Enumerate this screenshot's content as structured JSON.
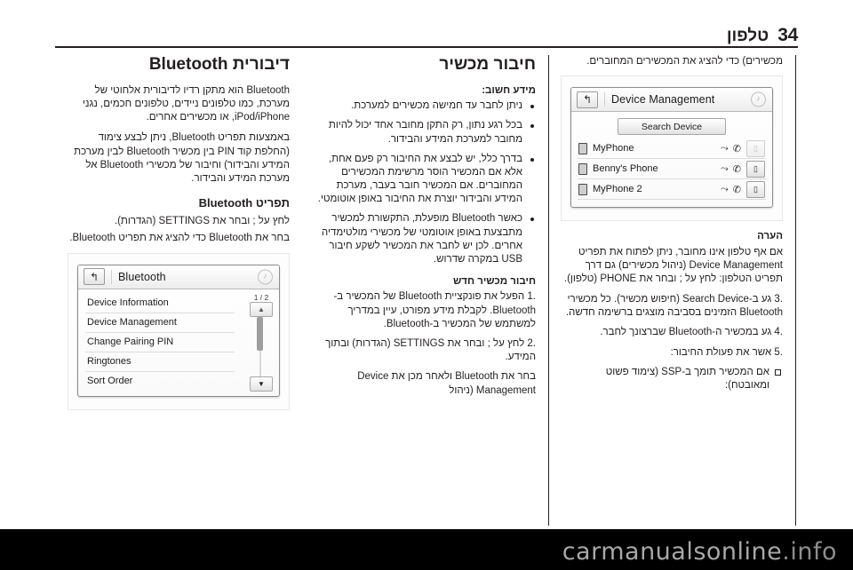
{
  "header": {
    "page_number": "34",
    "title": "טלפון"
  },
  "col_right": {
    "heading": "דיבורית Bluetooth",
    "intro_1": "Bluetooth הוא מתקן רדיו לדיבורית אלחוטי של מערכת, כמו טלפונים ניידים, טלפונים חכמים, נגני iPod/iPhone, או מכשירים אחרים.",
    "intro_2": "באמצעות תפריט Bluetooth, ניתן לבצע צימוד (החלפת קוד PIN בין מכשיר Bluetooth לבין מערכת המידע והבידור) וחיבור של מכשירי Bluetooth אל מערכת המידע והבידור.",
    "menu_heading": "תפריט Bluetooth",
    "menu_p1": "לחץ על ; ובחר את SETTINGS (הגדרות).",
    "menu_p2": "בחר את Bluetooth כדי להציג את תפריט Bluetooth.",
    "screen": {
      "title": "Bluetooth",
      "back_icon": "↰",
      "note_icon": "♪",
      "page_indicator": "1 / 2",
      "up_arrow": "▲",
      "down_arrow": "▼",
      "items": [
        "Device Information",
        "Device Management",
        "Change Pairing PIN",
        "Ringtones",
        "Sort Order"
      ]
    }
  },
  "col_mid": {
    "heading": "חיבור מכשיר",
    "subheading": "מידע חשוב:",
    "bullets": [
      "ניתן לחבר עד חמישה מכשירים למערכת.",
      "בכל רגע נתון, רק התקן מחובר אחד יכול להיות מחובר למערכת המידע והבידור.",
      "בדרך כלל, יש לבצע את החיבור רק פעם אחת, אלא אם המכשיר הוסר מרשימת המכשירים המחוברים. אם המכשיר חובר בעבר, מערכת המידע והבידור יוצרת את החיבור באופן אוטומטי.",
      "כאשר Bluetooth מופעלת, התקשורת למכשיר מתבצעת באופן אוטומטי של מכשירי מולטימדיה אחרים. לכן יש לחבר את המכשיר לשקע חיבור USB במקרה שדרוש."
    ],
    "steps_heading": "חיבור מכשיר חדש",
    "steps": [
      "הפעל את פונקציית Bluetooth של המכשיר ב-Bluetooth. לקבלת מידע מפורט, עיין במדריך למשתמש של המכשיר ב-Bluetooth.",
      "לחץ על ; ובחר את SETTINGS (הגדרות) ובתוך המידע.",
      "בחר את Bluetooth ולאחר מכן את Device Management (ניהול"
    ]
  },
  "col_left": {
    "intro_cont": "מכשירים) כדי להציג את המכשירים המחוברים.",
    "screen": {
      "title": "Device Management",
      "back_icon": "↰",
      "note_icon": "♪",
      "search_label": "Search Device",
      "devices": [
        {
          "name": "MyPhone",
          "sound_icon": "⤳",
          "phone_icon": "✆",
          "trash_icon": "▯",
          "trash_disabled": true
        },
        {
          "name": "Benny's Phone",
          "sound_icon": "⤳",
          "phone_icon": "✆",
          "trash_icon": "▯",
          "trash_disabled": false
        },
        {
          "name": "MyPhone 2",
          "sound_icon": "⤳",
          "phone_icon": "✆",
          "trash_icon": "▯",
          "trash_disabled": false
        }
      ]
    },
    "note_heading": "הערה",
    "note_body": "אם אף טלפון אינו מחובר, ניתן לפתוח את תפריט Device Management (ניהול מכשירים) גם דרך תפריט הטלפון: לחץ על ; ובחר את PHONE (טלפון).",
    "steps": [
      "גע ב-Search Device (חיפוש מכשיר). כל מכשירי Bluetooth הזמינים בסביבה מוצגים ברשימה חדשה.",
      "גע במכשיר ה-Bluetooth שברצונך לחבר.",
      "אשר את פעולת החיבור:"
    ],
    "sub_bullets": [
      "אם המכשיר תומך ב-SSP (צימוד פשוט ומאובטח):"
    ]
  },
  "watermark": {
    "text": "carmanualsonline",
    "suffix": ".info"
  }
}
